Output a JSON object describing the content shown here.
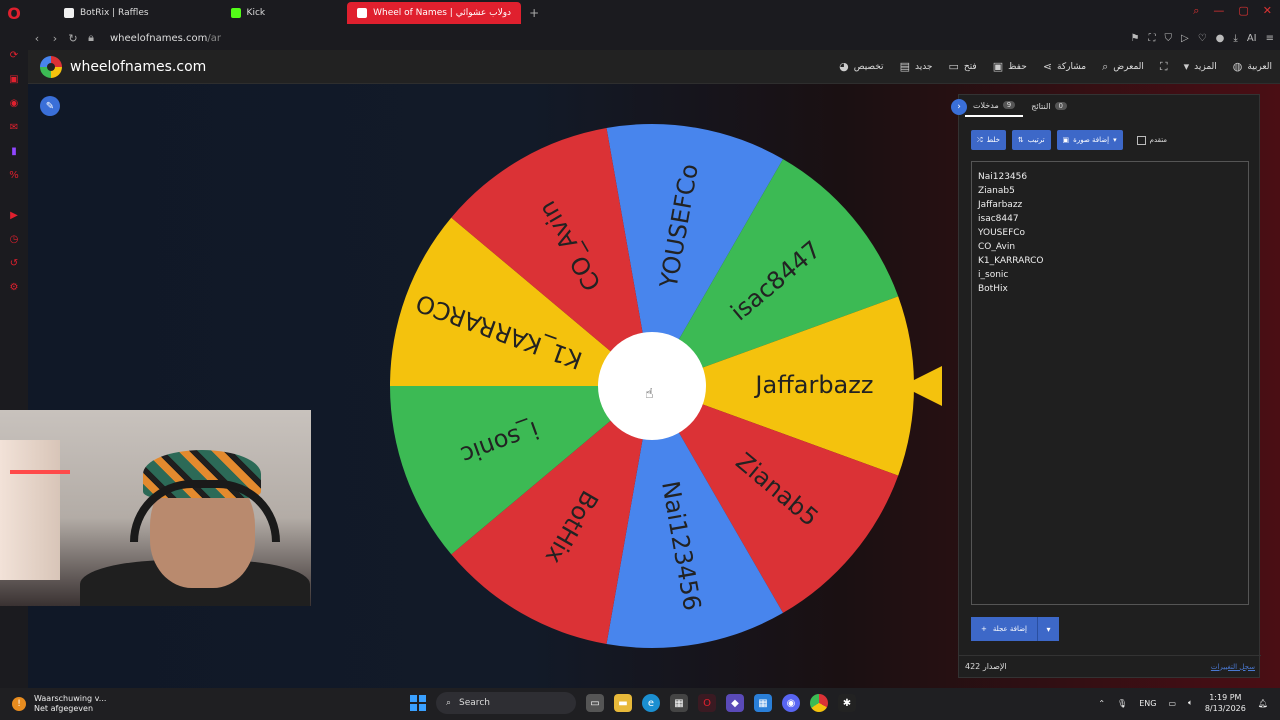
{
  "browser": {
    "tabs": [
      {
        "label": "BotRix | Raffles",
        "icon_color": "#f0f0f0",
        "active": false
      },
      {
        "label": "Kick",
        "icon_color": "#53fc18",
        "active": false
      },
      {
        "label": "Wheel of Names | دولاب عشوائي",
        "icon_color": "#ffffff",
        "active": true
      }
    ],
    "url_host": "wheelofnames.com",
    "url_path": "/ar",
    "ai_label": "AI"
  },
  "site": {
    "title": "wheelofnames.com",
    "menu": [
      {
        "label": "تخصيص",
        "icon": "palette-icon"
      },
      {
        "label": "جديد",
        "icon": "file-icon"
      },
      {
        "label": "فتح",
        "icon": "folder-icon"
      },
      {
        "label": "حفظ",
        "icon": "save-icon"
      },
      {
        "label": "مشاركة",
        "icon": "share-icon"
      },
      {
        "label": "المعرض",
        "icon": "search-icon"
      },
      {
        "label": "",
        "icon": "fullscreen-icon"
      },
      {
        "label": "المزيد",
        "icon": "dropdown-icon"
      },
      {
        "label": "العربية",
        "icon": "globe-icon"
      }
    ]
  },
  "wheel": {
    "segments": [
      {
        "name": "YOUSEFCo",
        "color": "#4885ed"
      },
      {
        "name": "isac8447",
        "color": "#3cba54"
      },
      {
        "name": "Jaffarbazz",
        "color": "#f4c20d"
      },
      {
        "name": "Zianab5",
        "color": "#db3236"
      },
      {
        "name": "Nai123456",
        "color": "#4885ed"
      },
      {
        "name": "BotHix",
        "color": "#db3236"
      },
      {
        "name": "i_sonic",
        "color": "#3cba54"
      },
      {
        "name": "K1_KARRARCO",
        "color": "#f4c20d"
      },
      {
        "name": "CO_Avin",
        "color": "#db3236"
      }
    ]
  },
  "panel": {
    "tabs": [
      {
        "label": "مدخلات",
        "count": "9"
      },
      {
        "label": "النتائج",
        "count": "0"
      }
    ],
    "buttons": {
      "shuffle": "خلط",
      "sort": "ترتيب",
      "add_image": "إضافة صورة",
      "advanced": "متقدم"
    },
    "entries": [
      "Nai123456",
      "Zianab5",
      "Jaffarbazz",
      "isac8447",
      "YOUSEFCo",
      "CO_Avin",
      "K1_KARRARCO",
      "i_sonic",
      "BotHix"
    ],
    "add_wheel": "إضافة عجلة",
    "version": "الإصدار 422",
    "changelog": "سجل التغييرات"
  },
  "taskbar": {
    "notification_title": "Waarschuwing v...",
    "notification_sub": "Net afgegeven",
    "search_placeholder": "Search",
    "lang": "ENG",
    "time": "1:19 PM",
    "date": "8/13/2026"
  }
}
